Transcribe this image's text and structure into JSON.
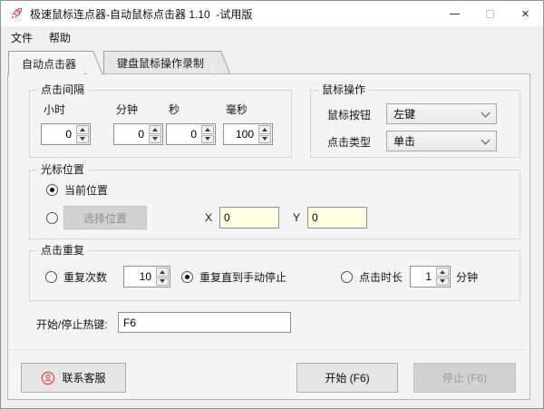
{
  "window": {
    "title": "极速鼠标连点器-自动鼠标点击器 1.10  -试用版"
  },
  "menu": {
    "items": [
      {
        "label": "文件"
      },
      {
        "label": "帮助"
      }
    ]
  },
  "tabs": [
    {
      "label": "自动点击器",
      "active": true
    },
    {
      "label": "键盘鼠标操作录制",
      "active": false
    }
  ],
  "click_interval": {
    "group_title": "点击间隔",
    "fields": [
      {
        "label": "小时",
        "value": "0"
      },
      {
        "label": "分钟",
        "value": "0"
      },
      {
        "label": "秒",
        "value": "0"
      },
      {
        "label": "毫秒",
        "value": "100"
      }
    ]
  },
  "mouse_action": {
    "group_title": "鼠标操作",
    "button_label": "鼠标按钮",
    "button_value": "左键",
    "type_label": "点击类型",
    "type_value": "单击"
  },
  "cursor_position": {
    "group_title": "光标位置",
    "current_label": "当前位置",
    "current_checked": true,
    "pick_button": "选择位置",
    "pick_checked": false,
    "x_label": "X",
    "x_value": "0",
    "y_label": "Y",
    "y_value": "0"
  },
  "click_repeat": {
    "group_title": "点击重复",
    "count_label": "重复次数",
    "count_value": "10",
    "count_checked": false,
    "until_label": "重复直到手动停止",
    "until_checked": true,
    "duration_label": "点击时长",
    "duration_value": "1",
    "duration_unit": "分钟",
    "duration_checked": false
  },
  "hotkey": {
    "label": "开始/停止热键:",
    "value": "F6"
  },
  "footer": {
    "contact": "联系客服",
    "start": "开始 (F6)",
    "stop": "停止 (F6)"
  },
  "colors": {
    "accent_red": "#cf4a43",
    "field_yellow": "#ffffe1"
  }
}
